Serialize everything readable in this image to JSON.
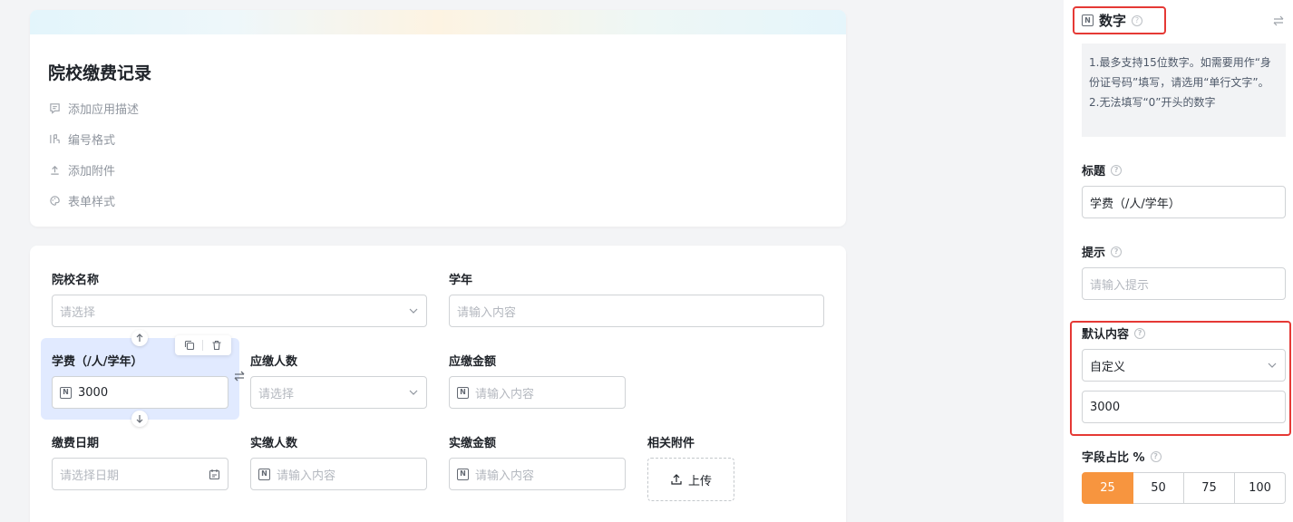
{
  "header": {
    "title": "院校缴费记录",
    "meta_items": [
      {
        "label": "添加应用描述",
        "icon": "comment-icon"
      },
      {
        "label": "编号格式",
        "icon": "number-format-icon"
      },
      {
        "label": "添加附件",
        "icon": "upload-icon"
      },
      {
        "label": "表单样式",
        "icon": "palette-icon"
      }
    ]
  },
  "form": {
    "school_name": {
      "label": "院校名称",
      "placeholder": "请选择"
    },
    "academic_year": {
      "label": "学年",
      "placeholder": "请输入内容"
    },
    "tuition": {
      "label": "学费（/人/学年）",
      "value": "3000"
    },
    "due_count": {
      "label": "应缴人数",
      "placeholder": "请选择"
    },
    "due_amount": {
      "label": "应缴金额",
      "placeholder": "请输入内容"
    },
    "pay_date": {
      "label": "缴费日期",
      "placeholder": "请选择日期"
    },
    "actual_count": {
      "label": "实缴人数",
      "placeholder": "请输入内容"
    },
    "actual_amount": {
      "label": "实缴金额",
      "placeholder": "请输入内容"
    },
    "attachment": {
      "label": "相关附件",
      "button": "上传"
    }
  },
  "panel": {
    "field_type": "数字",
    "tips": [
      "1.最多支持15位数字。如需要用作“身份证号码”填写，请选用“单行文字”。",
      "2.无法填写“0”开头的数字"
    ],
    "title_label": "标题",
    "title_value": "学费（/人/学年）",
    "hint_label": "提示",
    "hint_placeholder": "请输入提示",
    "default_label": "默认内容",
    "default_mode": "自定义",
    "default_value": "3000",
    "width_label": "字段占比 %",
    "width_options": [
      "25",
      "50",
      "75",
      "100"
    ],
    "width_selected": "25"
  },
  "colors": {
    "accent": "#f7953f",
    "selection": "#e1eaff",
    "highlight": "#e53935"
  }
}
